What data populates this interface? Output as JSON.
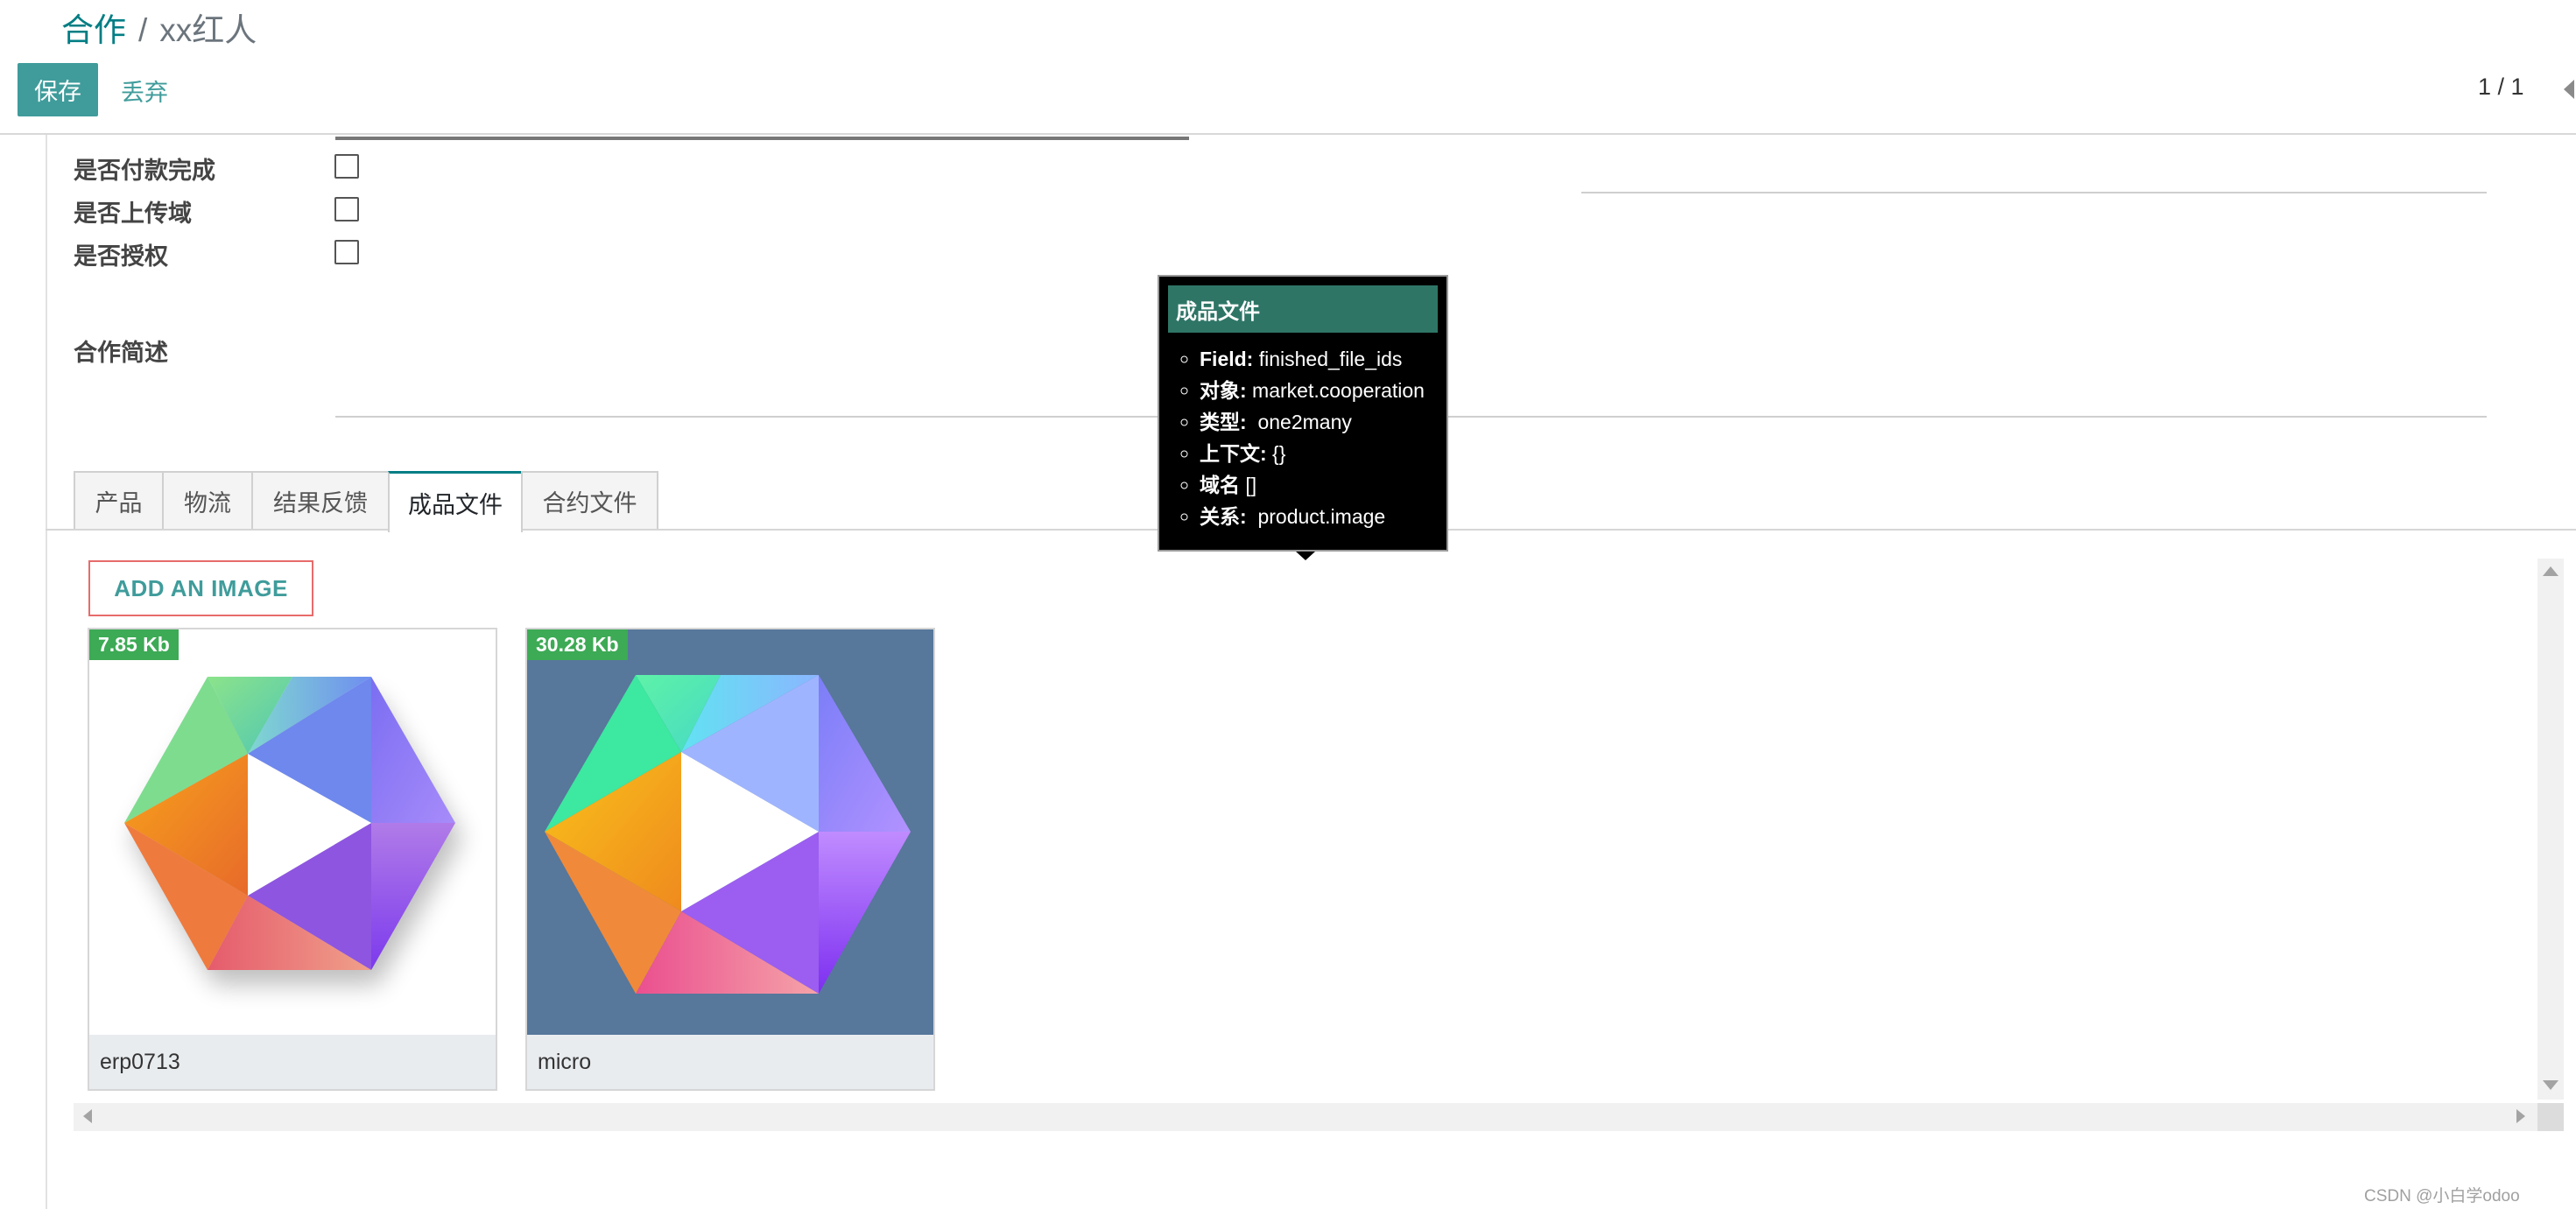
{
  "breadcrumb": {
    "parent": "合作",
    "separator": "/",
    "current": "xx红人"
  },
  "toolbar": {
    "save_label": "保存",
    "discard_label": "丢弃"
  },
  "pager": {
    "value": "1 / 1"
  },
  "fields": {
    "payment_done": {
      "label": "是否付款完成",
      "checked": false
    },
    "uploaded": {
      "label": "是否上传域",
      "checked": false
    },
    "authorized": {
      "label": "是否授权",
      "checked": false
    },
    "description": {
      "label": "合作简述",
      "value": ""
    }
  },
  "tabs": [
    {
      "label": "产品",
      "active": false
    },
    {
      "label": "物流",
      "active": false
    },
    {
      "label": "结果反馈",
      "active": false
    },
    {
      "label": "成品文件",
      "active": true
    },
    {
      "label": "合约文件",
      "active": false
    }
  ],
  "add_image_label": "ADD AN IMAGE",
  "images": [
    {
      "name": "erp0713",
      "size": "7.85 Kb",
      "background": "#ffffff"
    },
    {
      "name": "micro",
      "size": "30.28 Kb",
      "background": "#57779b"
    }
  ],
  "tooltip": {
    "title": "成品文件",
    "rows": [
      {
        "key": "Field:",
        "value": " finished_file_ids"
      },
      {
        "key": "对象:",
        "value": " market.cooperation"
      },
      {
        "key": "类型:",
        "value": "  one2many"
      },
      {
        "key": "上下文:",
        "value": " {}"
      },
      {
        "key": "域名",
        "value": " []"
      },
      {
        "key": "关系:",
        "value": "  product.image"
      }
    ]
  },
  "watermark": "CSDN @小白学odoo",
  "colors": {
    "primary": "#3f9c9b",
    "link": "#017e84",
    "badge": "#3daa55",
    "tooltip_header": "#2e7566"
  }
}
